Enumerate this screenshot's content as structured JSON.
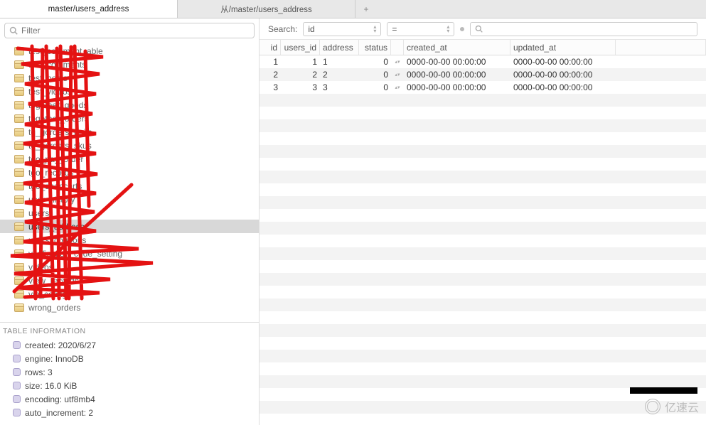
{
  "tabs": [
    {
      "label": "master/users_address",
      "active": true
    },
    {
      "label": "从/master/users_address",
      "active": false
    }
  ],
  "filter": {
    "placeholder": "Filter"
  },
  "tree": {
    "items": [
      {
        "label": "test_comment_able"
      },
      {
        "label": "test_comments"
      },
      {
        "label": "test_posts"
      },
      {
        "label": "test_videos"
      },
      {
        "label": "together_goods"
      },
      {
        "label": "together_orders"
      },
      {
        "label": "tg_gorders_units"
      },
      {
        "label": "tg_gorders_skus"
      },
      {
        "label": "tgo_pay_order"
      },
      {
        "label": "tgo_records"
      },
      {
        "label": "tgo_shopcarts"
      },
      {
        "label": "user_history"
      },
      {
        "label": "users"
      },
      {
        "label": "users_address",
        "selected": true
      },
      {
        "label": "users_coupons"
      },
      {
        "label": "verification_code_setting"
      },
      {
        "label": "videos"
      },
      {
        "label": "view_records"
      },
      {
        "label": "vip_config"
      },
      {
        "label": "wrong_orders"
      }
    ]
  },
  "table_info": {
    "header": "TABLE INFORMATION",
    "rows": [
      {
        "text": "created: 2020/6/27"
      },
      {
        "text": "engine: InnoDB"
      },
      {
        "text": "rows: 3"
      },
      {
        "text": "size: 16.0 KiB"
      },
      {
        "text": "encoding: utf8mb4"
      },
      {
        "text": "auto_increment: 2"
      }
    ]
  },
  "search": {
    "label": "Search:",
    "column": "id",
    "operator": "="
  },
  "grid": {
    "columns": [
      "id",
      "users_id",
      "address",
      "status",
      "created_at",
      "updated_at"
    ],
    "rows": [
      {
        "id": "1",
        "users_id": "1",
        "address": "1",
        "status": "0",
        "created_at": "0000-00-00 00:00:00",
        "updated_at": "0000-00-00 00:00:00"
      },
      {
        "id": "2",
        "users_id": "2",
        "address": "2",
        "status": "0",
        "created_at": "0000-00-00 00:00:00",
        "updated_at": "0000-00-00 00:00:00"
      },
      {
        "id": "3",
        "users_id": "3",
        "address": "3",
        "status": "0",
        "created_at": "0000-00-00 00:00:00",
        "updated_at": "0000-00-00 00:00:00"
      }
    ],
    "empty_rows": 25
  },
  "watermark": {
    "text": "亿速云"
  }
}
